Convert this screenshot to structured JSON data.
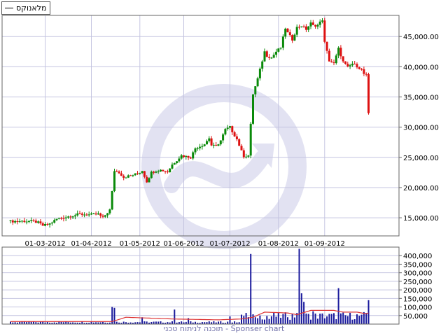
{
  "legend": {
    "series_name": "מלאנוקס",
    "line_color": "#000000"
  },
  "footer": {
    "text": "תוכנה לניתוח טכני - Sponser chart"
  },
  "colors": {
    "up": "#0a8a0a",
    "down": "#dd1111",
    "volume": "#1a1a9c",
    "volume_ma": "#dd3333",
    "grid": "#c4c4e0",
    "watermark": "#e2e2f2"
  },
  "chart_data": [
    {
      "type": "candlestick",
      "title": "",
      "series": [
        {
          "name": "מלאנוקס"
        }
      ],
      "x_tick_labels": [
        "01-03-2012",
        "01-04-2012",
        "01-05-2012",
        "01-06-2012",
        "01-07-2012",
        "01-08-2012",
        "01-09-2012"
      ],
      "y_tick_labels": [
        "15,000.00",
        "20,000.00",
        "25,000.00",
        "30,000.00",
        "35,000.00",
        "40,000.00",
        "45,000.00"
      ],
      "y_ticks": [
        15000,
        20000,
        25000,
        30000,
        35000,
        40000,
        45000
      ],
      "ylim": [
        12000,
        48500
      ],
      "grid": true,
      "x_scale_note": "index position of each monthly tick among the candles",
      "x_tick_positions": [
        15,
        35,
        56,
        75,
        95,
        116,
        136
      ],
      "total_candles": 162,
      "anchors": [
        [
          0,
          14400
        ],
        [
          5,
          14450
        ],
        [
          10,
          14400
        ],
        [
          12,
          14200
        ],
        [
          14,
          13700
        ],
        [
          17,
          14000
        ],
        [
          20,
          14800
        ],
        [
          25,
          15200
        ],
        [
          30,
          15600
        ],
        [
          35,
          15500
        ],
        [
          38,
          15600
        ],
        [
          40,
          15000
        ],
        [
          43,
          16300
        ],
        [
          44,
          19300
        ],
        [
          45,
          22800
        ],
        [
          47,
          22500
        ],
        [
          49,
          21700
        ],
        [
          51,
          21900
        ],
        [
          55,
          22300
        ],
        [
          57,
          22800
        ],
        [
          59,
          21000
        ],
        [
          61,
          22500
        ],
        [
          63,
          22800
        ],
        [
          65,
          22900
        ],
        [
          68,
          22600
        ],
        [
          70,
          23800
        ],
        [
          74,
          25300
        ],
        [
          78,
          25000
        ],
        [
          80,
          26500
        ],
        [
          84,
          27200
        ],
        [
          86,
          28200
        ],
        [
          87,
          27000
        ],
        [
          89,
          26800
        ],
        [
          91,
          27800
        ],
        [
          93,
          29600
        ],
        [
          95,
          30000
        ],
        [
          96,
          29300
        ],
        [
          98,
          28000
        ],
        [
          100,
          26000
        ],
        [
          101,
          25200
        ],
        [
          103,
          25300
        ],
        [
          105,
          35500
        ],
        [
          107,
          38000
        ],
        [
          110,
          42500
        ],
        [
          111,
          41800
        ],
        [
          113,
          41500
        ],
        [
          115,
          42500
        ],
        [
          117,
          43200
        ],
        [
          119,
          46400
        ],
        [
          120,
          45600
        ],
        [
          122,
          44500
        ],
        [
          124,
          46500
        ],
        [
          126,
          46800
        ],
        [
          128,
          46200
        ],
        [
          130,
          47200
        ],
        [
          131,
          46800
        ],
        [
          133,
          46900
        ],
        [
          135,
          47800
        ],
        [
          136,
          44000
        ],
        [
          138,
          41000
        ],
        [
          140,
          40500
        ],
        [
          142,
          43000
        ],
        [
          144,
          40800
        ],
        [
          146,
          39900
        ],
        [
          148,
          40500
        ],
        [
          150,
          40100
        ],
        [
          152,
          39500
        ],
        [
          153,
          38800
        ],
        [
          154,
          38600
        ],
        [
          155,
          32500
        ]
      ],
      "gap_after_index": 154
    },
    {
      "type": "bar",
      "series": [
        {
          "name": "volume"
        },
        {
          "name": "volume moving average"
        }
      ],
      "y_tick_labels": [
        "50,000",
        "100,000",
        "150,000",
        "200,000",
        "250,000",
        "300,000",
        "350,000",
        "400,000"
      ],
      "y_ticks": [
        50000,
        100000,
        150000,
        200000,
        250000,
        300000,
        350000,
        400000
      ],
      "ylim": [
        0,
        450000
      ],
      "baseline_volume": 12000,
      "spikes": [
        [
          44,
          100000
        ],
        [
          45,
          95000
        ],
        [
          57,
          40000
        ],
        [
          71,
          85000
        ],
        [
          77,
          35000
        ],
        [
          95,
          45000
        ],
        [
          100,
          55000
        ],
        [
          104,
          410000
        ],
        [
          106,
          40000
        ],
        [
          108,
          50000
        ],
        [
          112,
          30000
        ],
        [
          120,
          40000
        ],
        [
          124,
          65000
        ],
        [
          125,
          440000
        ],
        [
          126,
          180000
        ],
        [
          127,
          130000
        ],
        [
          131,
          75000
        ],
        [
          142,
          210000
        ],
        [
          152,
          55000
        ],
        [
          153,
          70000
        ],
        [
          154,
          65000
        ],
        [
          155,
          140000
        ]
      ],
      "ma_anchors": [
        [
          0,
          15000
        ],
        [
          44,
          15000
        ],
        [
          50,
          40000
        ],
        [
          70,
          30000
        ],
        [
          90,
          25000
        ],
        [
          100,
          30000
        ],
        [
          105,
          40000
        ],
        [
          110,
          70000
        ],
        [
          120,
          65000
        ],
        [
          124,
          55000
        ],
        [
          130,
          80000
        ],
        [
          140,
          80000
        ],
        [
          144,
          70000
        ],
        [
          150,
          70000
        ],
        [
          154,
          60000
        ],
        [
          155,
          65000
        ]
      ]
    }
  ]
}
